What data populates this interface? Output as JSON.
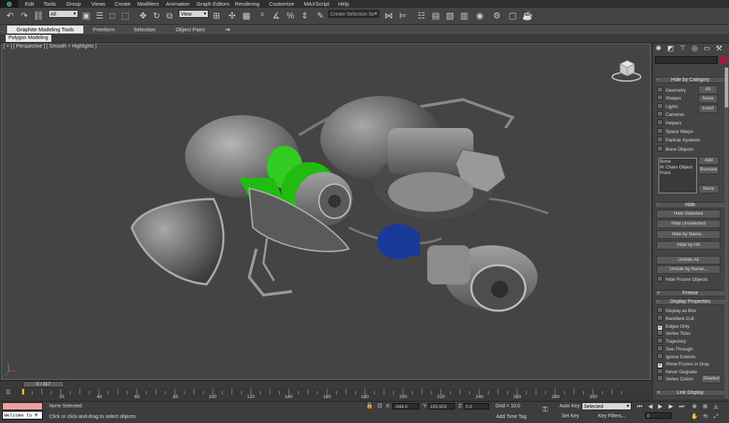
{
  "menubar": {
    "items": [
      "Edit",
      "Tools",
      "Group",
      "Views",
      "Create",
      "Modifiers",
      "Animation",
      "Graph Editors",
      "Rendering",
      "Customize",
      "MAXScript",
      "Help"
    ]
  },
  "toolbar": {
    "selection_filter": "All",
    "ref_coord": "View",
    "named_selection_placeholder": "Create Selection Se"
  },
  "ribbon": {
    "tabs": [
      "Graphite Modeling Tools",
      "Freeform",
      "Selection",
      "Object Paint"
    ],
    "active_tab": "Graphite Modeling Tools",
    "panel": "Polygon Modeling"
  },
  "viewport": {
    "label": "[ + ] [ Perspective ] [ Smooth + Highlights ]"
  },
  "command_panel": {
    "hide_by_category": {
      "title": "Hide by Category",
      "items": [
        {
          "label": "Geometry",
          "checked": false
        },
        {
          "label": "Shapes",
          "checked": false
        },
        {
          "label": "Lights",
          "checked": false
        },
        {
          "label": "Cameras",
          "checked": false
        },
        {
          "label": "Helpers",
          "checked": false
        },
        {
          "label": "Space Warps",
          "checked": false
        },
        {
          "label": "Particle Systems",
          "checked": false
        },
        {
          "label": "Bone Objects",
          "checked": false
        }
      ],
      "buttons": [
        "All",
        "None",
        "Invert"
      ],
      "list": [
        "Bone",
        "IK Chain Object",
        "Point"
      ],
      "list_buttons": [
        "Add",
        "Remove",
        "None"
      ]
    },
    "hide": {
      "title": "Hide",
      "buttons": [
        "Hide Selected",
        "Hide Unselected",
        "Hide by Name...",
        "Hide by Hit",
        "Unhide All",
        "Unhide by Name..."
      ],
      "hide_frozen": "Hide Frozen Objects"
    },
    "freeze": {
      "title": "Freeze"
    },
    "display_properties": {
      "title": "Display Properties",
      "items": [
        {
          "label": "Display as Box",
          "checked": false
        },
        {
          "label": "Backface Cull",
          "checked": false
        },
        {
          "label": "Edges Only",
          "checked": true
        },
        {
          "label": "Vertex Ticks",
          "checked": false
        },
        {
          "label": "Trajectory",
          "checked": false
        },
        {
          "label": "See-Through",
          "checked": false
        },
        {
          "label": "Ignore Extents",
          "checked": false
        },
        {
          "label": "Show Frozen in Gray",
          "checked": true
        },
        {
          "label": "Never Degrade",
          "checked": false
        },
        {
          "label": "Vertex Colors",
          "checked": false
        }
      ],
      "shaded_button": "Shaded"
    },
    "link_display": {
      "title": "Link Display"
    }
  },
  "timeline": {
    "frame": "0 / 317",
    "ticks": [
      "20",
      "40",
      "60",
      "80",
      "100",
      "120",
      "140",
      "160",
      "180",
      "200",
      "220",
      "240",
      "260",
      "280",
      "300"
    ]
  },
  "status": {
    "selection": "None Selected",
    "prompt": "Click or click-and-drag to select objects",
    "listener": "Welcome to M",
    "x_label": "X:",
    "x": "-344.0",
    "y_label": "Y:",
    "y": "155.503",
    "z_label": "Z:",
    "z": "0.0",
    "grid": "Grid = 10.0",
    "add_time_tag": "Add Time Tag",
    "auto_key": "Auto Key",
    "set_key": "Set Key",
    "key_mode": "Selected",
    "key_filters": "Key Filters...",
    "current_frame": "0"
  }
}
